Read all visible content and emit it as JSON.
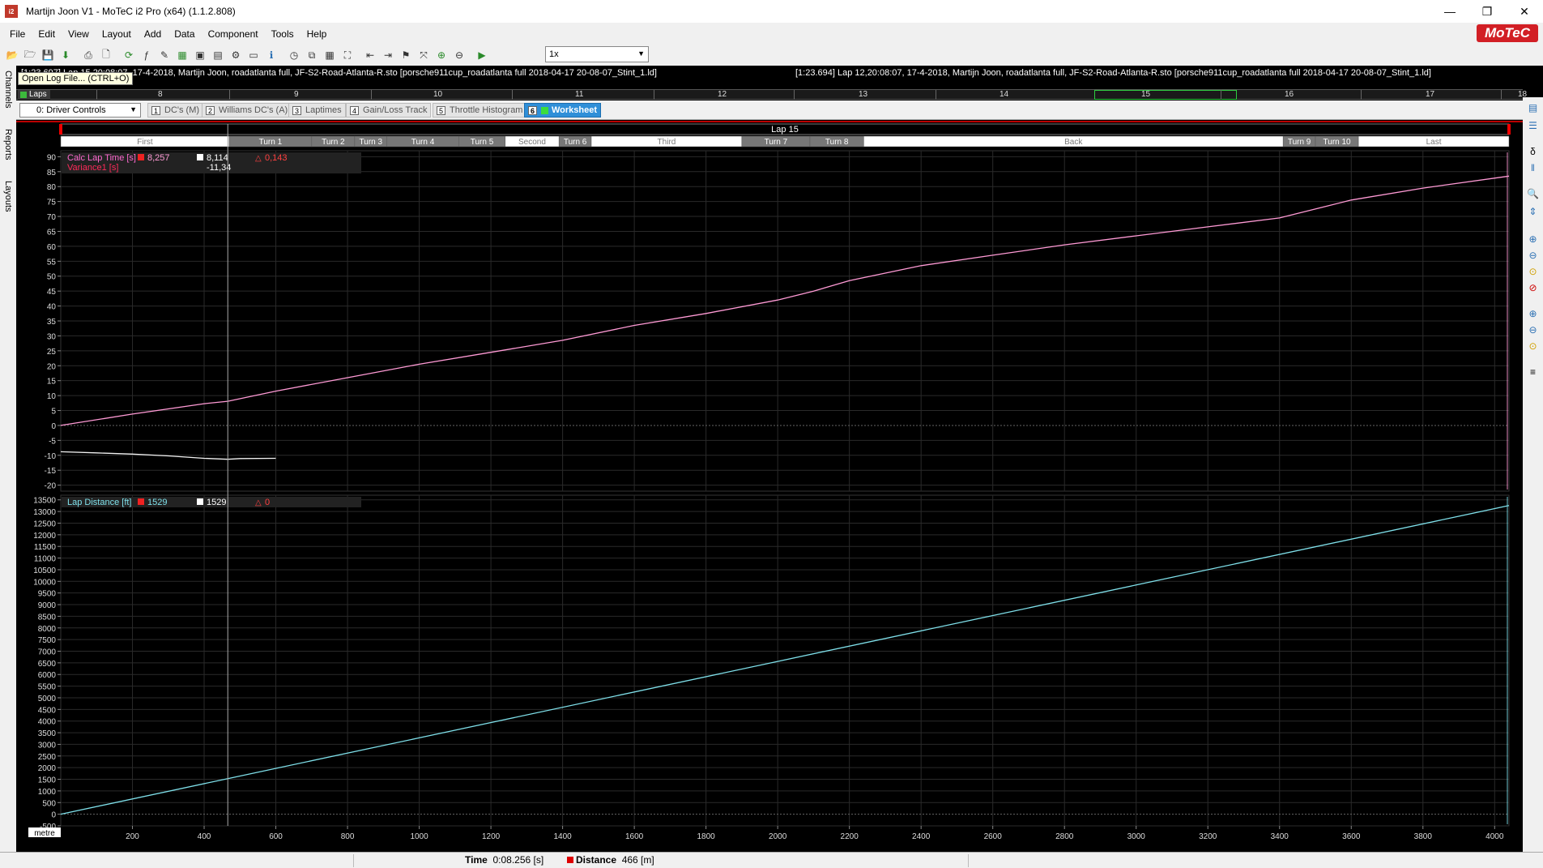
{
  "window": {
    "title": "Martijn Joon V1 - MoTeC i2 Pro (x64) (1.1.2.808)",
    "icon_text": "i2",
    "minimize": "—",
    "restore": "❐",
    "close": "✕"
  },
  "menu": [
    "File",
    "Edit",
    "View",
    "Layout",
    "Add",
    "Data",
    "Component",
    "Tools",
    "Help"
  ],
  "brand": "MoTeC",
  "toolbar": {
    "playback_speed": "1x"
  },
  "tooltip": "Open Log File... (CTRL+O)",
  "left_tabs": [
    "Channels",
    "Reports",
    "Layouts"
  ],
  "logs": {
    "log1": "[1:23.697] Lap 15,20:08:07, 17-4-2018,  Martijn Joon, roadatlanta full, JF-S2-Road-Atlanta-R.sto [porsche911cup_roadatlanta full 2018-04-17 20-08-07_Stint_1.ld]",
    "log2": "[1:23.694] Lap 12,20:08:07, 17-4-2018,  Martijn Joon, roadatlanta full, JF-S2-Road-Atlanta-R.sto [porsche911cup_roadatlanta full 2018-04-17 20-08-07_Stint_1.ld]"
  },
  "laps_row": {
    "label": "Laps",
    "laps": [
      "8",
      "9",
      "10",
      "11",
      "12",
      "13",
      "14",
      "15",
      "16",
      "17",
      "18"
    ],
    "selected": "15"
  },
  "worksheet": {
    "driver_select": "0: Driver Controls",
    "tabs": [
      {
        "num": "1",
        "label": "DC's (M)"
      },
      {
        "num": "2",
        "label": "Williams DC's (A)"
      },
      {
        "num": "3",
        "label": "Laptimes"
      },
      {
        "num": "4",
        "label": "Gain/Loss Track"
      },
      {
        "num": "5",
        "label": "Throttle Histogram"
      },
      {
        "num": "6",
        "label": "Worksheet"
      }
    ],
    "active_tab": "Worksheet"
  },
  "graph": {
    "lap_title": "Lap 15",
    "sections": [
      {
        "label": "First",
        "from": 0,
        "to": 470
      },
      {
        "label": "Turn 1",
        "from": 470,
        "to": 700
      },
      {
        "label": "Turn 2",
        "from": 700,
        "to": 820
      },
      {
        "label": "Turn 3",
        "from": 820,
        "to": 910
      },
      {
        "label": "Turn 4",
        "from": 910,
        "to": 1110
      },
      {
        "label": "Turn 5",
        "from": 1110,
        "to": 1240
      },
      {
        "label": "Second",
        "from": 1240,
        "to": 1390
      },
      {
        "label": "Turn 6",
        "from": 1390,
        "to": 1480
      },
      {
        "label": "Third",
        "from": 1480,
        "to": 1900
      },
      {
        "label": "Turn 7",
        "from": 1900,
        "to": 2090
      },
      {
        "label": "Turn 8",
        "from": 2090,
        "to": 2240
      },
      {
        "label": "Back",
        "from": 2240,
        "to": 3410
      },
      {
        "label": "Turn 9",
        "from": 3410,
        "to": 3500
      },
      {
        "label": "Turn 10",
        "from": 3500,
        "to": 3620
      },
      {
        "label": "Last",
        "from": 3620,
        "to": 4040
      }
    ],
    "cursor_x": 466,
    "x_unit_label": "metre",
    "x_ticks": [
      200,
      400,
      600,
      800,
      1000,
      1200,
      1400,
      1600,
      1800,
      2000,
      2200,
      2400,
      2600,
      2800,
      3000,
      3200,
      3400,
      3600,
      3800,
      4000
    ]
  },
  "chart_data": [
    {
      "type": "line",
      "title": "",
      "series": [
        {
          "name": "Calc Lap Time [s]",
          "color": "#ff9ad5",
          "x": [
            0,
            200,
            400,
            466,
            600,
            800,
            1000,
            1200,
            1400,
            1600,
            1800,
            2000,
            2100,
            2200,
            2400,
            2600,
            2800,
            3000,
            3200,
            3400,
            3600,
            3800,
            4040
          ],
          "values": [
            0,
            3.8,
            7.3,
            8.1,
            11.5,
            16,
            20.5,
            24.5,
            28.5,
            33.5,
            37.5,
            42,
            45,
            48.5,
            53.5,
            57,
            60.5,
            63.5,
            66.5,
            69.5,
            75.5,
            79.5,
            83.5
          ]
        },
        {
          "name": "Variance1 [s]",
          "color": "#f2f2f2",
          "x": [
            0,
            100,
            200,
            300,
            400,
            466,
            500,
            600
          ],
          "values": [
            -8.8,
            -9.2,
            -9.6,
            -10.2,
            -11,
            -11.34,
            -11.1,
            -11
          ]
        }
      ],
      "ylim": [
        -22,
        92
      ],
      "y_ticks": [
        -20,
        -15,
        -10,
        -5,
        0,
        5,
        10,
        15,
        20,
        25,
        30,
        35,
        40,
        45,
        50,
        55,
        60,
        65,
        70,
        75,
        80,
        85,
        90
      ],
      "legend": [
        {
          "channel": "Calc Lap Time [s]",
          "value_ref": "8,257",
          "value_cursor": "8,114",
          "delta": "0,143"
        },
        {
          "channel": "Variance1 [s]",
          "value_cursor": "-11,34"
        }
      ]
    },
    {
      "type": "line",
      "title": "",
      "series": [
        {
          "name": "Lap Distance [ft]",
          "color": "#7fe0ea",
          "x": [
            0,
            466,
            1000,
            2000,
            3000,
            4040
          ],
          "values": [
            0,
            1529,
            3281,
            6562,
            9843,
            13255
          ]
        }
      ],
      "ylim": [
        -500,
        13700
      ],
      "y_ticks": [
        -500,
        0,
        500,
        1000,
        1500,
        2000,
        2500,
        3000,
        3500,
        4000,
        4500,
        5000,
        5500,
        6000,
        6500,
        7000,
        7500,
        8000,
        8500,
        9000,
        9500,
        10000,
        10500,
        11000,
        11500,
        12000,
        12500,
        13000,
        13500
      ],
      "legend": [
        {
          "channel": "Lap Distance [ft]",
          "value_ref": "1529",
          "value_cursor": "1529",
          "delta": "0"
        }
      ]
    }
  ],
  "status": {
    "time_label": "Time",
    "time_value": "0:08.256 [s]",
    "distance_label": "Distance",
    "distance_value": "466 [m]"
  }
}
